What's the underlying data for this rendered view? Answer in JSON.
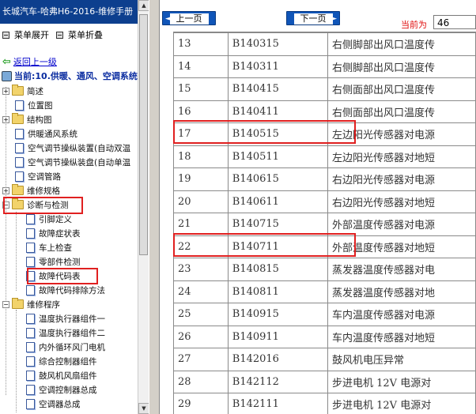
{
  "app": {
    "title": "长城汽车-哈弗H6-2016-维修手册"
  },
  "toolbar": {
    "expand_label": "菜单展开",
    "collapse_label": "菜单折叠"
  },
  "nav": {
    "back_label": "返回上一级",
    "current_label": "当前:10.供暖、通风、空调系统"
  },
  "tree": {
    "n0": "简述",
    "n1": "位置图",
    "n2": "结构图",
    "n3": "供暖通风系统",
    "n4": "空气调节操纵装置(自动双温",
    "n5": "空气调节操纵装盘(自动单温",
    "n6": "空调管路",
    "n7": "维修规格",
    "n8": "诊断与检测",
    "n9": "引脚定义",
    "n10": "故障症状表",
    "n11": "车上检查",
    "n12": "零部件检测",
    "n13": "故障代码表",
    "n14": "故障代码排除方法",
    "n15": "维修程序",
    "n16": "温度执行器组件一",
    "n17": "温度执行器组件二",
    "n18": "内外循环风门电机",
    "n19": "综合控制器组件",
    "n20": "鼓风机风扇组件",
    "n21": "空调控制器总成",
    "n22": "空调器总成"
  },
  "pager": {
    "prev_label": "上一页",
    "next_label": "下一页",
    "current_page_label": "当前为",
    "current_page_value": "46"
  },
  "table": {
    "rows": [
      {
        "no": "13",
        "code": "B140315",
        "desc": "右侧脚部出风口温度传"
      },
      {
        "no": "14",
        "code": "B140311",
        "desc": "右侧脚部出风口温度传"
      },
      {
        "no": "15",
        "code": "B140415",
        "desc": "右侧面部出风口温度传"
      },
      {
        "no": "16",
        "code": "B140411",
        "desc": "右侧面部出风口温度传"
      },
      {
        "no": "17",
        "code": "B140515",
        "desc": "左边阳光传感器对电源"
      },
      {
        "no": "18",
        "code": "B140511",
        "desc": "左边阳光传感器对地短"
      },
      {
        "no": "19",
        "code": "B140615",
        "desc": "右边阳光传感器对电源"
      },
      {
        "no": "20",
        "code": "B140611",
        "desc": "右边阳光传感器对地短"
      },
      {
        "no": "21",
        "code": "B140715",
        "desc": "外部温度传感器对电源"
      },
      {
        "no": "22",
        "code": "B140711",
        "desc": "外部温度传感器对地短"
      },
      {
        "no": "23",
        "code": "B140815",
        "desc": "蒸发器温度传感器对电"
      },
      {
        "no": "24",
        "code": "B140811",
        "desc": "蒸发器温度传感器对地"
      },
      {
        "no": "25",
        "code": "B140915",
        "desc": "车内温度传感器对电源"
      },
      {
        "no": "26",
        "code": "B140911",
        "desc": "车内温度传感器对地短"
      },
      {
        "no": "27",
        "code": "B142016",
        "desc": "鼓风机电压异常"
      },
      {
        "no": "28",
        "code": "B142112",
        "desc": "步进电机 12V 电源对"
      },
      {
        "no": "29",
        "code": "B142111",
        "desc": "步进电机 12V 电源对"
      }
    ]
  },
  "colors": {
    "title_bg": "#0d3f8e",
    "highlight": "#e02020",
    "link": "#0000cc",
    "nav_btn": "#1055b8"
  }
}
